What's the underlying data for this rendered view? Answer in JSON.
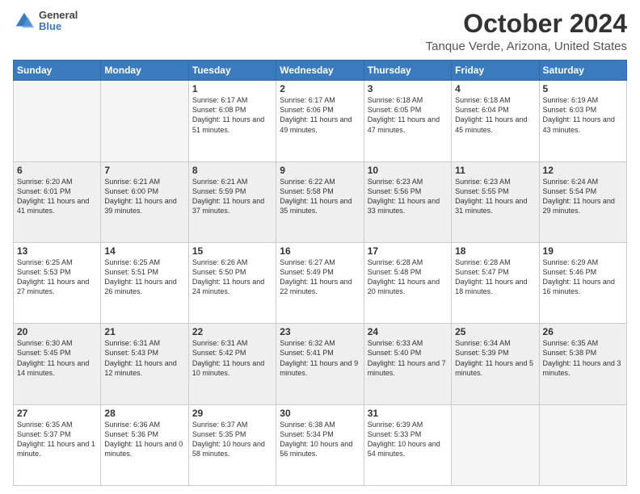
{
  "logo": {
    "line1": "General",
    "line2": "Blue"
  },
  "title": "October 2024",
  "subtitle": "Tanque Verde, Arizona, United States",
  "weekdays": [
    "Sunday",
    "Monday",
    "Tuesday",
    "Wednesday",
    "Thursday",
    "Friday",
    "Saturday"
  ],
  "weeks": [
    [
      {
        "day": "",
        "empty": true
      },
      {
        "day": "",
        "empty": true
      },
      {
        "day": "1",
        "sunrise": "6:17 AM",
        "sunset": "6:08 PM",
        "daylight": "11 hours and 51 minutes."
      },
      {
        "day": "2",
        "sunrise": "6:17 AM",
        "sunset": "6:06 PM",
        "daylight": "11 hours and 49 minutes."
      },
      {
        "day": "3",
        "sunrise": "6:18 AM",
        "sunset": "6:05 PM",
        "daylight": "11 hours and 47 minutes."
      },
      {
        "day": "4",
        "sunrise": "6:18 AM",
        "sunset": "6:04 PM",
        "daylight": "11 hours and 45 minutes."
      },
      {
        "day": "5",
        "sunrise": "6:19 AM",
        "sunset": "6:03 PM",
        "daylight": "11 hours and 43 minutes."
      }
    ],
    [
      {
        "day": "6",
        "sunrise": "6:20 AM",
        "sunset": "6:01 PM",
        "daylight": "11 hours and 41 minutes."
      },
      {
        "day": "7",
        "sunrise": "6:21 AM",
        "sunset": "6:00 PM",
        "daylight": "11 hours and 39 minutes."
      },
      {
        "day": "8",
        "sunrise": "6:21 AM",
        "sunset": "5:59 PM",
        "daylight": "11 hours and 37 minutes."
      },
      {
        "day": "9",
        "sunrise": "6:22 AM",
        "sunset": "5:58 PM",
        "daylight": "11 hours and 35 minutes."
      },
      {
        "day": "10",
        "sunrise": "6:23 AM",
        "sunset": "5:56 PM",
        "daylight": "11 hours and 33 minutes."
      },
      {
        "day": "11",
        "sunrise": "6:23 AM",
        "sunset": "5:55 PM",
        "daylight": "11 hours and 31 minutes."
      },
      {
        "day": "12",
        "sunrise": "6:24 AM",
        "sunset": "5:54 PM",
        "daylight": "11 hours and 29 minutes."
      }
    ],
    [
      {
        "day": "13",
        "sunrise": "6:25 AM",
        "sunset": "5:53 PM",
        "daylight": "11 hours and 27 minutes."
      },
      {
        "day": "14",
        "sunrise": "6:25 AM",
        "sunset": "5:51 PM",
        "daylight": "11 hours and 26 minutes."
      },
      {
        "day": "15",
        "sunrise": "6:26 AM",
        "sunset": "5:50 PM",
        "daylight": "11 hours and 24 minutes."
      },
      {
        "day": "16",
        "sunrise": "6:27 AM",
        "sunset": "5:49 PM",
        "daylight": "11 hours and 22 minutes."
      },
      {
        "day": "17",
        "sunrise": "6:28 AM",
        "sunset": "5:48 PM",
        "daylight": "11 hours and 20 minutes."
      },
      {
        "day": "18",
        "sunrise": "6:28 AM",
        "sunset": "5:47 PM",
        "daylight": "11 hours and 18 minutes."
      },
      {
        "day": "19",
        "sunrise": "6:29 AM",
        "sunset": "5:46 PM",
        "daylight": "11 hours and 16 minutes."
      }
    ],
    [
      {
        "day": "20",
        "sunrise": "6:30 AM",
        "sunset": "5:45 PM",
        "daylight": "11 hours and 14 minutes."
      },
      {
        "day": "21",
        "sunrise": "6:31 AM",
        "sunset": "5:43 PM",
        "daylight": "11 hours and 12 minutes."
      },
      {
        "day": "22",
        "sunrise": "6:31 AM",
        "sunset": "5:42 PM",
        "daylight": "11 hours and 10 minutes."
      },
      {
        "day": "23",
        "sunrise": "6:32 AM",
        "sunset": "5:41 PM",
        "daylight": "11 hours and 9 minutes."
      },
      {
        "day": "24",
        "sunrise": "6:33 AM",
        "sunset": "5:40 PM",
        "daylight": "11 hours and 7 minutes."
      },
      {
        "day": "25",
        "sunrise": "6:34 AM",
        "sunset": "5:39 PM",
        "daylight": "11 hours and 5 minutes."
      },
      {
        "day": "26",
        "sunrise": "6:35 AM",
        "sunset": "5:38 PM",
        "daylight": "11 hours and 3 minutes."
      }
    ],
    [
      {
        "day": "27",
        "sunrise": "6:35 AM",
        "sunset": "5:37 PM",
        "daylight": "11 hours and 1 minute."
      },
      {
        "day": "28",
        "sunrise": "6:36 AM",
        "sunset": "5:36 PM",
        "daylight": "11 hours and 0 minutes."
      },
      {
        "day": "29",
        "sunrise": "6:37 AM",
        "sunset": "5:35 PM",
        "daylight": "10 hours and 58 minutes."
      },
      {
        "day": "30",
        "sunrise": "6:38 AM",
        "sunset": "5:34 PM",
        "daylight": "10 hours and 56 minutes."
      },
      {
        "day": "31",
        "sunrise": "6:39 AM",
        "sunset": "5:33 PM",
        "daylight": "10 hours and 54 minutes."
      },
      {
        "day": "",
        "empty": true
      },
      {
        "day": "",
        "empty": true
      }
    ]
  ]
}
